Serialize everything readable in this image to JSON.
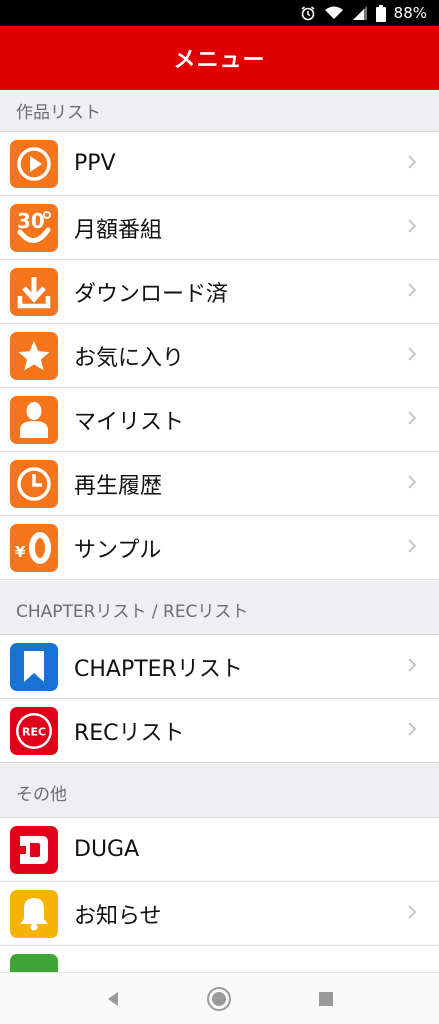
{
  "status_bar": {
    "battery_text": "88%",
    "icons": [
      "alarm-icon",
      "wifi-icon",
      "signal-icon",
      "battery-icon"
    ]
  },
  "header": {
    "title": "メニュー"
  },
  "sections": [
    {
      "title": "作品リスト",
      "items": [
        {
          "label": "PPV",
          "icon": "play-icon",
          "color": "#f4751c",
          "chevron": true
        },
        {
          "label": "月額番組",
          "icon": "thirty-days-icon",
          "color": "#f4751c",
          "chevron": true
        },
        {
          "label": "ダウンロード済",
          "icon": "download-icon",
          "color": "#f4751c",
          "chevron": true
        },
        {
          "label": "お気に入り",
          "icon": "star-icon",
          "color": "#f4751c",
          "chevron": true
        },
        {
          "label": "マイリスト",
          "icon": "person-icon",
          "color": "#f4751c",
          "chevron": true
        },
        {
          "label": "再生履歴",
          "icon": "clock-icon",
          "color": "#f4751c",
          "chevron": true
        },
        {
          "label": "サンプル",
          "icon": "yen-zero-icon",
          "color": "#f4751c",
          "chevron": true
        }
      ]
    },
    {
      "title": "CHAPTERリスト / RECリスト",
      "items": [
        {
          "label": "CHAPTERリスト",
          "icon": "bookmark-icon",
          "color": "#1673d4",
          "chevron": true
        },
        {
          "label": "RECリスト",
          "icon": "rec-icon",
          "color": "#e0001a",
          "icon_text": "REC",
          "chevron": true
        }
      ]
    },
    {
      "title": "その他",
      "items": [
        {
          "label": "DUGA",
          "icon": "duga-logo-icon",
          "color": "#e0001a",
          "chevron": false
        },
        {
          "label": "お知らせ",
          "icon": "bell-icon",
          "color": "#f5b400",
          "chevron": true
        }
      ]
    }
  ],
  "nav_bar": {
    "buttons": [
      "back-icon",
      "home-icon",
      "recents-icon"
    ]
  },
  "colors": {
    "header": "#e00000",
    "accent_orange": "#f4751c",
    "chevron": "#c7c7cc"
  }
}
